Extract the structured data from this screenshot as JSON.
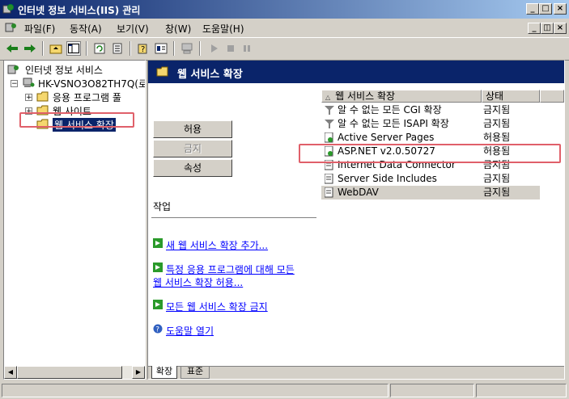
{
  "window": {
    "title": "인터넷 정보 서비스(IIS) 관리"
  },
  "menu": [
    "파일(F)",
    "동작(A)",
    "보기(V)",
    "창(W)",
    "도움말(H)"
  ],
  "tree": {
    "root": "인터넷 정보 서비스",
    "server": "HK-VSNO3O82TH7Q(로",
    "items": [
      "응용 프로그램 풀",
      "웹 사이트",
      "웹 서비스 확장"
    ]
  },
  "right": {
    "header": "웹 서비스 확장",
    "buttons": {
      "allow": "허용",
      "deny": "금지",
      "properties": "속성"
    },
    "tasks_title": "작업",
    "tasks": [
      "새 웹 서비스 확장 추가...",
      "특정 응용 프로그램에 대해 모든",
      "웹 서비스 확장 허용...",
      "모든 웹 서비스 확장 금지",
      "도움말 열기"
    ],
    "columns": {
      "name": "웹 서비스 확장",
      "status": "상태"
    },
    "rows": [
      {
        "name": "알 수 없는 모든 CGI 확장",
        "status": "금지됨"
      },
      {
        "name": "알 수 없는 모든 ISAPI 확장",
        "status": "금지됨"
      },
      {
        "name": "Active Server Pages",
        "status": "허용됨"
      },
      {
        "name": "ASP.NET v2.0.50727",
        "status": "허용됨"
      },
      {
        "name": "Internet Data Connector",
        "status": "금지됨"
      },
      {
        "name": "Server Side Includes",
        "status": "금지됨"
      },
      {
        "name": "WebDAV",
        "status": "금지됨"
      }
    ],
    "tabs": [
      "확장",
      "표준"
    ]
  },
  "colors": {
    "titlebar_start": "#0a246a",
    "titlebar_end": "#a6caf0",
    "highlight": "#e0606a",
    "link": "#0000ff"
  }
}
